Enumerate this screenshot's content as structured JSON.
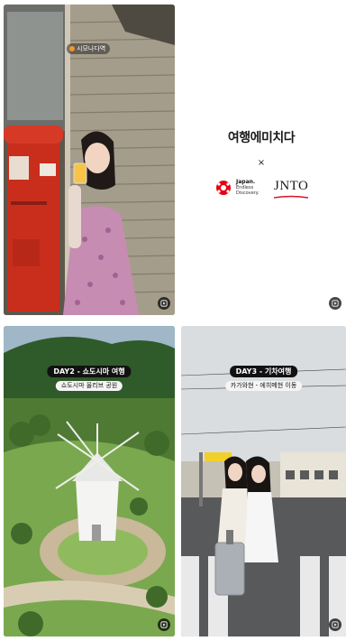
{
  "grid": {
    "tiles": [
      {
        "location_tag": "시모나다역"
      },
      {
        "brand_title": "여행에미치다",
        "times": "×",
        "japan_logo": {
          "line1": "Japan.",
          "line2": "Endless",
          "line3": "Discovery."
        },
        "jnto_logo": "JNTO"
      },
      {
        "day_label": "DAY2 - 쇼도시마 여행",
        "sub_label": "쇼도시마 올리브 공원"
      },
      {
        "day_label": "DAY3 - 기차여행",
        "sub_label": "카가와현 - 에히메현 이동"
      }
    ],
    "reel_icon": "reel-icon"
  },
  "colors": {
    "accent_red": "#e60012",
    "jnto_red": "#d7142a",
    "tag_dot": "#f2962e"
  }
}
